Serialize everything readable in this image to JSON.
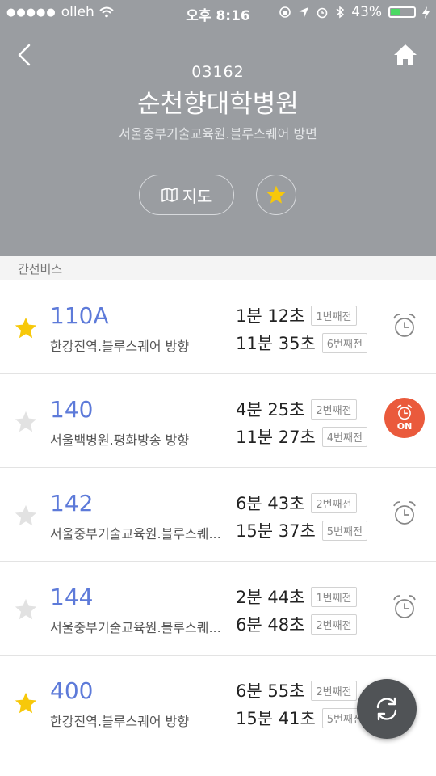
{
  "status_bar": {
    "carrier": "olleh",
    "time": "오후 8:16",
    "battery": "43%",
    "battery_level": 0.43,
    "battery_color": "#4cd964"
  },
  "header": {
    "stop_id": "03162",
    "stop_name": "순천향대학병원",
    "direction": "서울중부기술교육원.블루스퀘어 방면",
    "map_label": "지도",
    "favorited": true,
    "background_color": "#9a9da1"
  },
  "section_title": "간선버스",
  "buses": [
    {
      "route": "110A",
      "direction": "한강진역.블루스퀘어 방향",
      "favorite": true,
      "arrivals": [
        {
          "time": "1분 12초",
          "stops": "1번째전"
        },
        {
          "time": "11분 35초",
          "stops": "6번째전"
        }
      ],
      "alarm_on": false
    },
    {
      "route": "140",
      "direction": "서울백병원.평화방송 방향",
      "favorite": false,
      "arrivals": [
        {
          "time": "4분 25초",
          "stops": "2번째전"
        },
        {
          "time": "11분 27초",
          "stops": "4번째전"
        }
      ],
      "alarm_on": true,
      "alarm_label": "ON"
    },
    {
      "route": "142",
      "direction": "서울중부기술교육원.블루스퀘...",
      "favorite": false,
      "arrivals": [
        {
          "time": "6분 43초",
          "stops": "2번째전"
        },
        {
          "time": "15분 37초",
          "stops": "5번째전"
        }
      ],
      "alarm_on": false
    },
    {
      "route": "144",
      "direction": "서울중부기술교육원.블루스퀘...",
      "favorite": false,
      "arrivals": [
        {
          "time": "2분 44초",
          "stops": "1번째전"
        },
        {
          "time": "6분 48초",
          "stops": "2번째전"
        }
      ],
      "alarm_on": false
    },
    {
      "route": "400",
      "direction": "한강진역.블루스퀘어 방향",
      "favorite": true,
      "arrivals": [
        {
          "time": "6분 55초",
          "stops": "2번째전"
        },
        {
          "time": "15분 41초",
          "stops": "5번째전"
        }
      ],
      "alarm_on": false
    }
  ],
  "colors": {
    "accent": "#5d7ad9",
    "star_active": "#f7c80a",
    "star_inactive": "#e2e2e2",
    "alarm_on": "#ea5a3c"
  },
  "icons": [
    "back-arrow-icon",
    "home-icon",
    "map-icon",
    "star-icon",
    "alarm-clock-icon",
    "refresh-icon"
  ]
}
